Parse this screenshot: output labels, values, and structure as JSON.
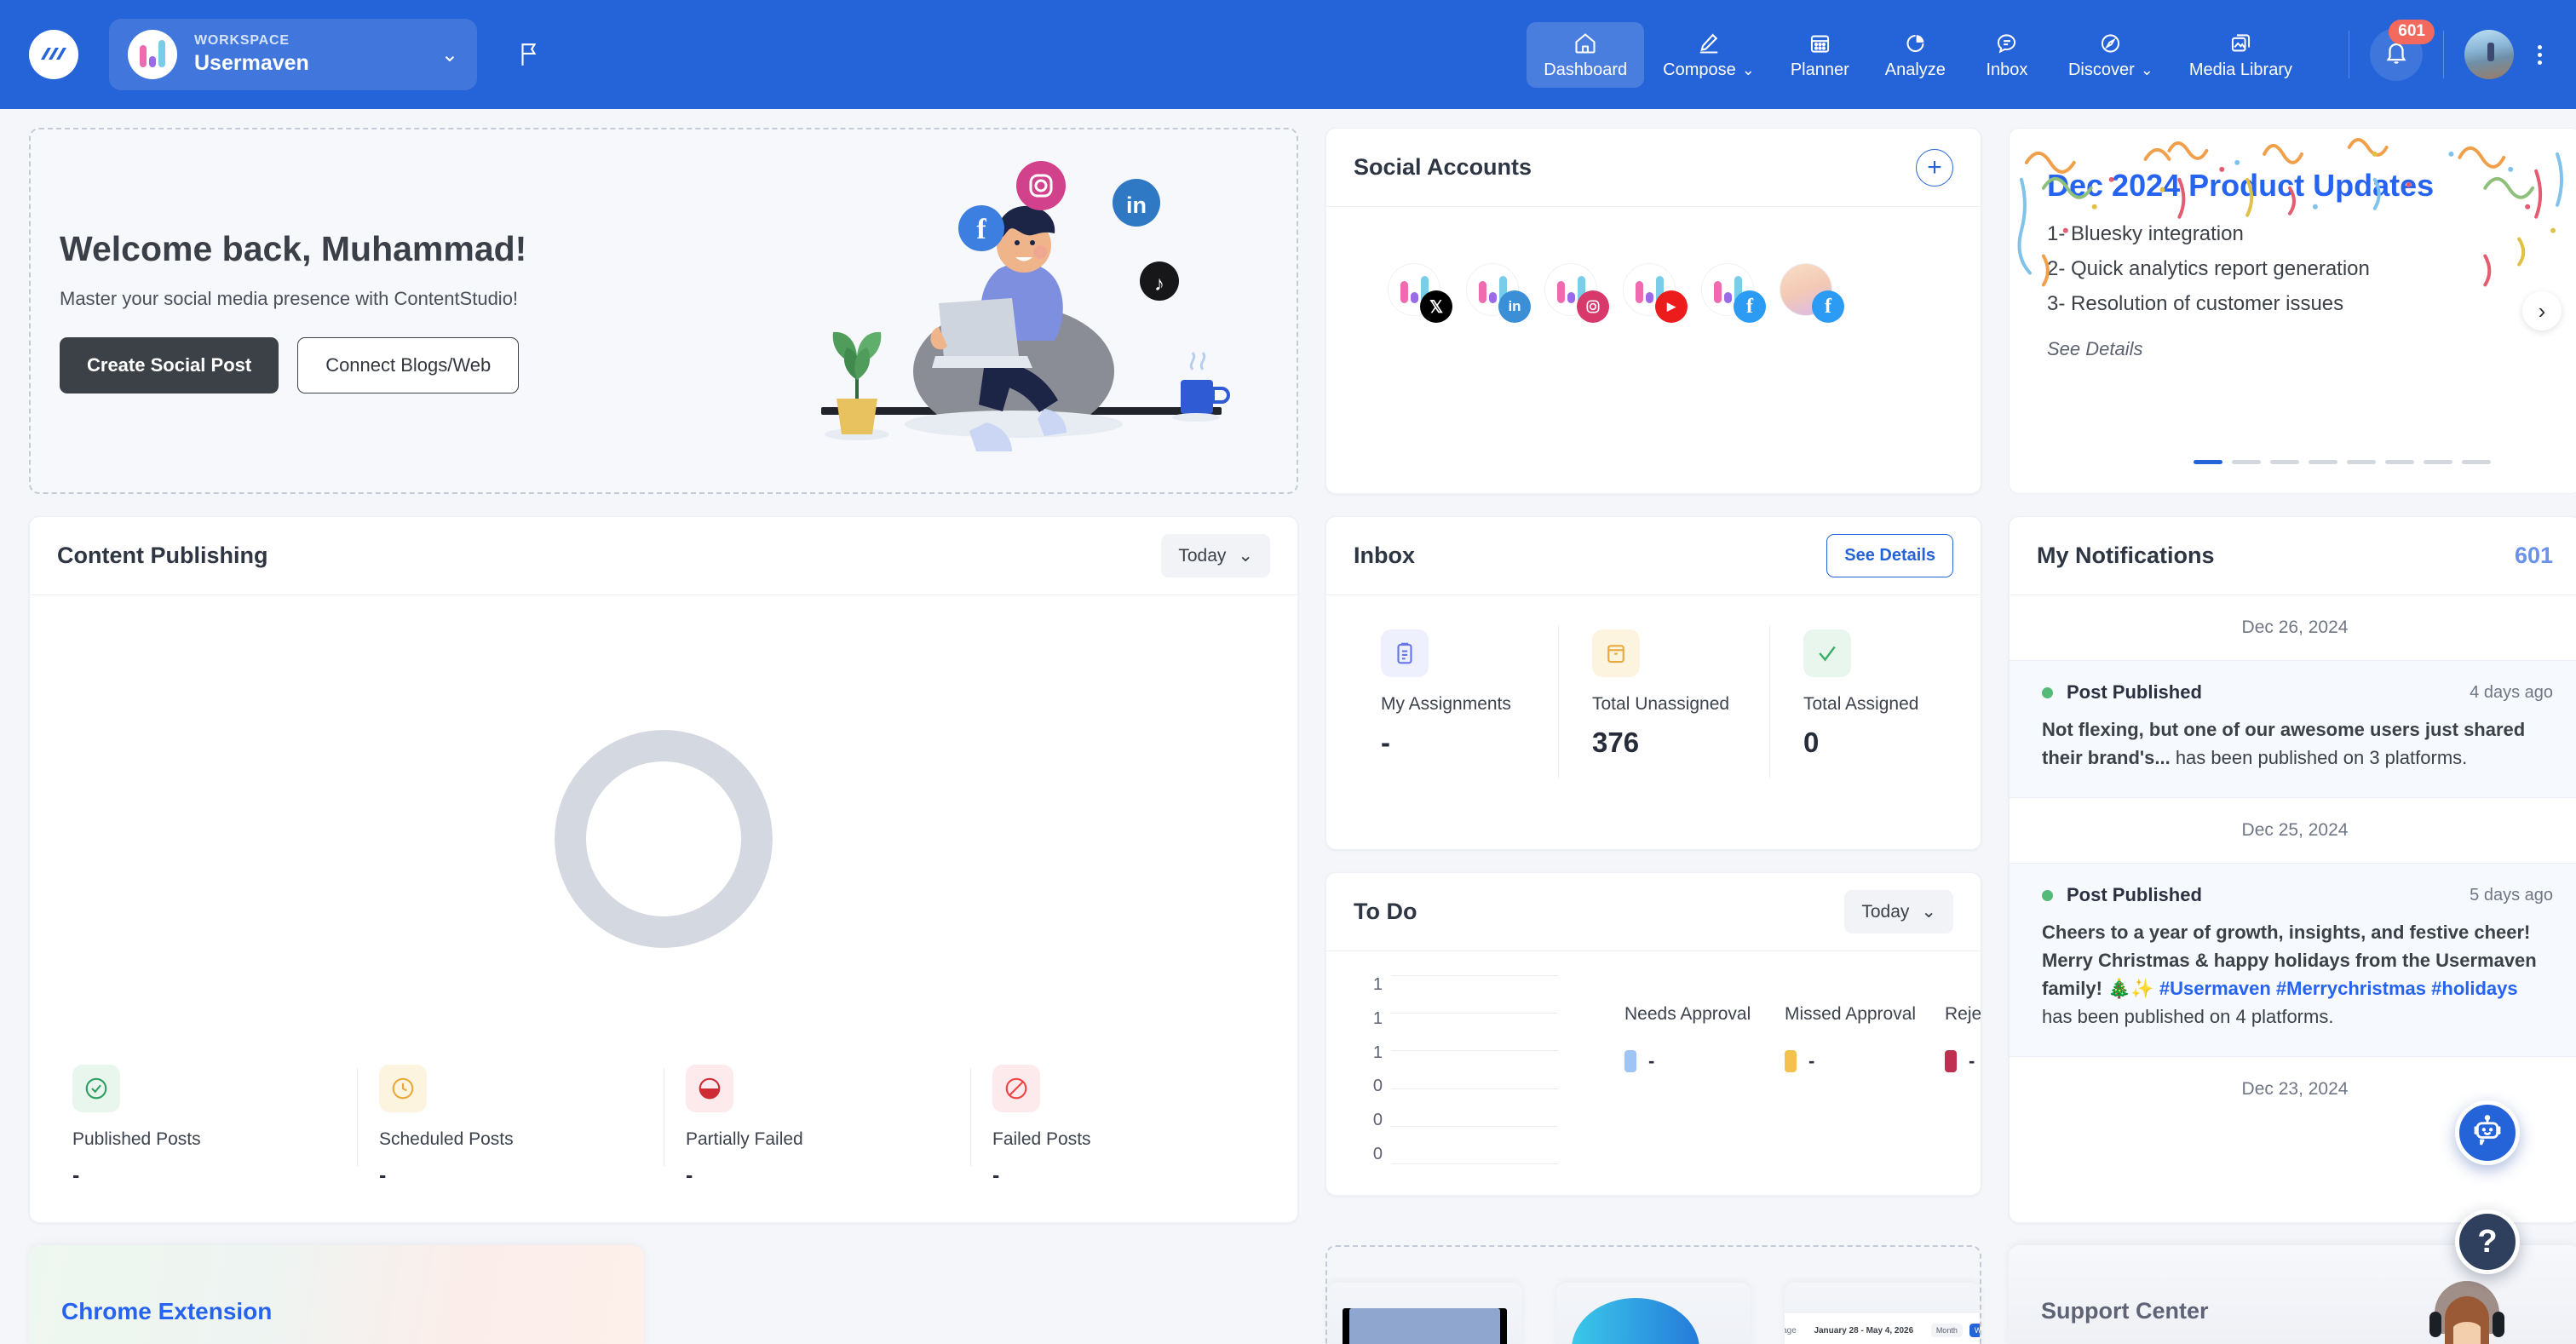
{
  "topbar": {
    "workspace_label": "WORKSPACE",
    "workspace_name": "Usermaven",
    "nav": [
      {
        "label": "Dashboard",
        "icon": "home-icon",
        "active": true,
        "caret": false
      },
      {
        "label": "Compose",
        "icon": "pencil-icon",
        "active": false,
        "caret": true
      },
      {
        "label": "Planner",
        "icon": "calendar-icon",
        "active": false,
        "caret": false
      },
      {
        "label": "Analyze",
        "icon": "pie-chart-icon",
        "active": false,
        "caret": false
      },
      {
        "label": "Inbox",
        "icon": "message-icon",
        "active": false,
        "caret": false
      },
      {
        "label": "Discover",
        "icon": "compass-icon",
        "active": false,
        "caret": true
      },
      {
        "label": "Media Library",
        "icon": "image-icon",
        "active": false,
        "caret": false
      }
    ],
    "notification_badge": "601"
  },
  "welcome": {
    "title": "Welcome back, Muhammad!",
    "subtitle": "Master your social media presence with ContentStudio!",
    "primary_button": "Create Social Post",
    "secondary_button": "Connect Blogs/Web"
  },
  "social_accounts": {
    "title": "Social Accounts",
    "add_label": "+",
    "accounts": [
      {
        "platform": "x",
        "glyph": "X",
        "color": "#000000"
      },
      {
        "platform": "linkedin",
        "glyph": "in",
        "color": "#3b8fd6"
      },
      {
        "platform": "instagram",
        "glyph": "◎",
        "color": "#d8396b"
      },
      {
        "platform": "youtube",
        "glyph": "▶",
        "color": "#ed1c1c"
      },
      {
        "platform": "facebook",
        "glyph": "f",
        "color": "#2b9bf4"
      },
      {
        "platform": "facebook",
        "glyph": "f",
        "color": "#2b9bf4"
      }
    ]
  },
  "product_updates": {
    "title": "Dec 2024 Product Updates",
    "items": [
      "1- Bluesky integration",
      "2- Quick analytics report generation",
      "3- Resolution of customer issues"
    ],
    "link": "See Details",
    "dots_total": 8,
    "dots_active_index": 0
  },
  "content_publishing": {
    "title": "Content Publishing",
    "range_label": "Today",
    "stats": [
      {
        "label": "Published Posts",
        "value": "-",
        "icon": "check-circle-icon",
        "color": "#2f9e63",
        "bg": "#e8f6ed"
      },
      {
        "label": "Scheduled Posts",
        "value": "-",
        "icon": "clock-icon",
        "color": "#e7a93a",
        "bg": "#fdf4e0"
      },
      {
        "label": "Partially Failed",
        "value": "-",
        "icon": "half-circle-icon",
        "color": "#cf2b35",
        "bg": "#fdeaec"
      },
      {
        "label": "Failed Posts",
        "value": "-",
        "icon": "ban-icon",
        "color": "#ef4444",
        "bg": "#fdeaec"
      }
    ]
  },
  "inbox": {
    "title": "Inbox",
    "see_details": "See Details",
    "stats": [
      {
        "label": "My Assignments",
        "value": "-",
        "icon": "clipboard-icon",
        "color": "#6675e8",
        "bg": "#eef0fd"
      },
      {
        "label": "Total Unassigned",
        "value": "376",
        "icon": "inbox-icon",
        "color": "#e7a93a",
        "bg": "#fdf4e0"
      },
      {
        "label": "Total Assigned",
        "value": "0",
        "icon": "check-icon",
        "color": "#3fae6a",
        "bg": "#e8f6ed"
      }
    ]
  },
  "todo": {
    "title": "To Do",
    "range_label": "Today",
    "legend": [
      {
        "label": "Needs Approval",
        "value": "-",
        "color": "#9ec5f5"
      },
      {
        "label": "Missed Approval",
        "value": "-",
        "color": "#f2c14e"
      },
      {
        "label": "Rejected Posts",
        "value": "-",
        "color": "#c02f4f"
      }
    ]
  },
  "notifications": {
    "title": "My Notifications",
    "count": "601",
    "groups": [
      {
        "date": "Dec 26, 2024",
        "items": [
          {
            "kind": "Post Published",
            "ago": "4 days ago",
            "bold": "Not flexing, but one of our awesome users just shared their brand's...",
            "rest": " has been published on 3 platforms.",
            "hashtags": []
          }
        ]
      },
      {
        "date": "Dec 25, 2024",
        "items": [
          {
            "kind": "Post Published",
            "ago": "5 days ago",
            "bold": "Cheers to a year of growth, insights, and festive cheer! Merry Christmas & happy holidays from the Usermaven family! 🎄✨ ",
            "hashtags": [
              "#Usermaven",
              "#Merrychristmas",
              "#holidays"
            ],
            "rest": " has been published on 4 platforms."
          }
        ]
      },
      {
        "date": "Dec 23, 2024",
        "items": []
      }
    ]
  },
  "bottom": {
    "chrome_extension_title": "Chrome Extension",
    "support_center_title": "Support Center"
  },
  "floating": {
    "bot_icon": "chat-bot-icon",
    "help_label": "?"
  },
  "chart_data": [
    {
      "type": "pie",
      "title": "Content Publishing",
      "categories": [
        "Published Posts",
        "Scheduled Posts",
        "Partially Failed",
        "Failed Posts"
      ],
      "values": [
        0,
        0,
        0,
        0
      ],
      "empty_state": true,
      "note": "Donut rendered as 4 equal empty grey segments (no data for Today)",
      "colors": [
        "#d4d8e0",
        "#d4d8e0",
        "#d4d8e0",
        "#d4d8e0"
      ]
    },
    {
      "type": "bar",
      "title": "To Do",
      "categories": [
        "Needs Approval",
        "Missed Approval",
        "Rejected Posts"
      ],
      "values": [
        0,
        0,
        0
      ],
      "series": [
        {
          "name": "Needs Approval",
          "values": [
            0
          ],
          "color": "#9ec5f5"
        },
        {
          "name": "Missed Approval",
          "values": [
            0
          ],
          "color": "#f2c14e"
        },
        {
          "name": "Rejected Posts",
          "values": [
            0
          ],
          "color": "#c02f4f"
        }
      ],
      "ytick_labels": [
        "1",
        "1",
        "1",
        "0",
        "0",
        "0"
      ],
      "ylim": [
        0,
        1
      ],
      "grid": true,
      "legend_position": "right",
      "empty_state": true
    }
  ]
}
